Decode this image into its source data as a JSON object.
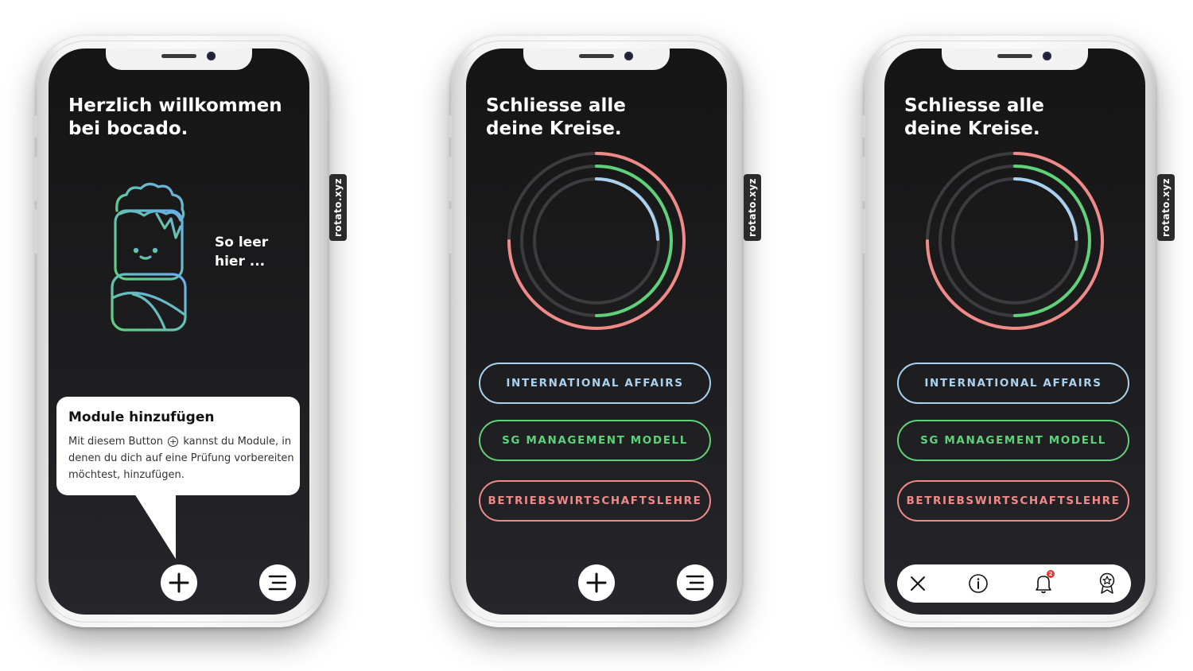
{
  "colors": {
    "blue": "#aad2f0",
    "green": "#5fd17b",
    "red": "#f08a88",
    "screen_bg": "#1a1a1c",
    "badge": "#e0382e"
  },
  "watermark": "rotato.xyz",
  "screens": [
    {
      "title_line1": "Herzlich willkommen",
      "title_line2": "bei bocado.",
      "empty_state": {
        "line1": "So leer",
        "line2": "hier ..."
      },
      "tooltip": {
        "title": "Module hinzufügen",
        "text_before_icon": "Mit diesem Button",
        "text_after_icon": "kannst du Module, in denen du dich auf eine Prüfung vorbereiten möchtest, hinzufügen."
      },
      "buttons": {
        "add_icon": "plus-icon",
        "menu_icon": "menu-icon"
      }
    },
    {
      "title_line1": "Schliesse alle",
      "title_line2": "deine Kreise.",
      "modules": [
        {
          "label": "INTERNATIONAL AFFAIRS",
          "color": "#aad2f0"
        },
        {
          "label": "SG MANAGEMENT MODELL",
          "color": "#5fd17b"
        },
        {
          "label": "BETRIEBSWIRTSCHAFTSLEHRE",
          "color": "#f08a88"
        }
      ],
      "buttons": {
        "add_icon": "plus-icon",
        "menu_icon": "menu-icon"
      }
    },
    {
      "title_line1": "Schliesse alle",
      "title_line2": "deine Kreise.",
      "modules": [
        {
          "label": "INTERNATIONAL AFFAIRS",
          "color": "#aad2f0"
        },
        {
          "label": "SG MANAGEMENT MODELL",
          "color": "#5fd17b"
        },
        {
          "label": "BETRIEBSWIRTSCHAFTSLEHRE",
          "color": "#f08a88"
        }
      ],
      "tabbar": {
        "items": [
          "close-icon",
          "info-icon",
          "bell-icon",
          "award-icon"
        ],
        "badge_count": "2"
      }
    }
  ]
}
